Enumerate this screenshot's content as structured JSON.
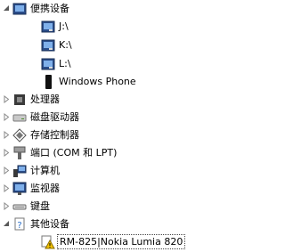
{
  "tree": {
    "portable_devices": {
      "label": "便携设备",
      "children": [
        {
          "label": "J:\\"
        },
        {
          "label": "K:\\"
        },
        {
          "label": "L:\\"
        },
        {
          "label": "Windows Phone"
        }
      ]
    },
    "categories": [
      {
        "label": "处理器",
        "icon": "processor-icon"
      },
      {
        "label": "磁盘驱动器",
        "icon": "disk-drive-icon"
      },
      {
        "label": "存储控制器",
        "icon": "storage-controller-icon"
      },
      {
        "label": "端口 (COM 和 LPT)",
        "icon": "port-icon"
      },
      {
        "label": "计算机",
        "icon": "computer-icon"
      },
      {
        "label": "监视器",
        "icon": "monitor-icon"
      },
      {
        "label": "键盘",
        "icon": "keyboard-icon"
      }
    ],
    "other_devices": {
      "label": "其他设备",
      "children": [
        {
          "label": "RM-825|Nokia Lumia 820",
          "icon": "warning-device-icon"
        }
      ]
    }
  }
}
